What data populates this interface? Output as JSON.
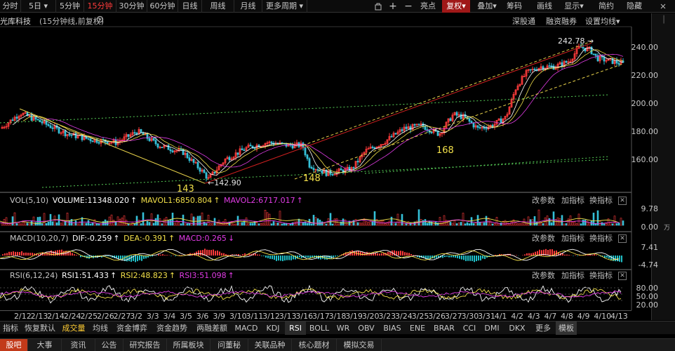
{
  "toolbar": {
    "periods": [
      "分时",
      "5日",
      "5分钟",
      "15分钟",
      "30分钟",
      "60分钟",
      "日线",
      "周线",
      "月线",
      "更多周期"
    ],
    "active_period": "15分钟",
    "right_buttons": [
      "亮点",
      "复权",
      "叠加",
      "筹码",
      "画线",
      "显示",
      "简约",
      "隐藏"
    ],
    "icons": [
      "pin-icon",
      "plus-icon",
      "minus-icon"
    ]
  },
  "title": {
    "stock_name": "光库科技",
    "sub": "(15分钟线,前复权)",
    "links": [
      "深股通",
      "融资融券",
      "设置均线"
    ]
  },
  "chart_data": {
    "type": "candlestick",
    "y_axis_ticks": [
      "240.00",
      "220.00",
      "200.00",
      "180.00",
      "160.00"
    ],
    "ylim": [
      142.9,
      242.78
    ],
    "annotations": {
      "high_label": "242.78",
      "low_label": "142.90",
      "wave_labels": [
        "143",
        "148",
        "168"
      ]
    },
    "x_dates": [
      "2/12",
      "2/13",
      "2/14",
      "2/24",
      "2/25",
      "2/26",
      "2/27",
      "3/2",
      "3/3",
      "3/4",
      "3/5",
      "3/6",
      "3/9",
      "3/10",
      "3/11",
      "3/12",
      "3/13",
      "3/16",
      "3/17",
      "3/18",
      "3/19",
      "3/20",
      "3/23",
      "3/24",
      "3/25",
      "3/26",
      "3/27",
      "3/30",
      "3/31",
      "4/1",
      "4/2",
      "4/3",
      "4/7",
      "4/8",
      "4/9",
      "4/10",
      "4/13"
    ],
    "trend_lines": [
      "uptrend-upper",
      "uptrend-lower",
      "downtrend",
      "support",
      "resistance"
    ]
  },
  "vol": {
    "name": "VOL(5,10)",
    "volume_label": "VOLUME:11348.020",
    "mavol1": "MAVOL1:6850.804",
    "mavol2": "MAVOL2:6717.017",
    "ticks": [
      "9.78",
      "0.00"
    ],
    "unit": "万"
  },
  "macd": {
    "name": "MACD(10,20,7)",
    "dif": "DIF:-0.259",
    "dea": "DEA:-0.391",
    "macd": "MACD:0.265",
    "ticks": [
      "7.41",
      "-4.74"
    ]
  },
  "rsi": {
    "name": "RSI(6,12,24)",
    "rsi1": "RSI1:51.433",
    "rsi2": "RSI2:48.823",
    "rsi3": "RSI3:51.098",
    "ticks": [
      "80.00",
      "50.00",
      "20.00"
    ]
  },
  "panel_controls": [
    "改参数",
    "加指标",
    "换指标"
  ],
  "indicator_tabs": [
    "指标",
    "恢复默认",
    "成交量",
    "均线",
    "资金博弈",
    "资金趋势",
    "两融差额",
    "MACD",
    "KDJ",
    "RSI",
    "BOLL",
    "WR",
    "OBV",
    "BIAS",
    "ENE",
    "BRAR",
    "CCI",
    "DMI",
    "DKX",
    "更多",
    "模板"
  ],
  "active_indicator": "RSI",
  "bottom_nav": [
    "股吧",
    "大事",
    "资讯",
    "公告",
    "研究报告",
    "所属板块",
    "问董秘",
    "关联品种",
    "核心题材",
    "模拟交易"
  ],
  "colors": {
    "up": "#ff3b3b",
    "down": "#35c0d8",
    "yellow": "#f2e04a",
    "magenta": "#e23ce6",
    "green_dotted": "#58d058",
    "brand_red": "#c23a1a"
  }
}
